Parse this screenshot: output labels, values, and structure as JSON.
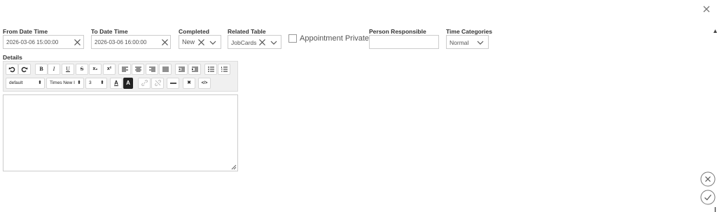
{
  "form": {
    "from_date": {
      "label": "From Date Time",
      "value": "2026-03-06 15:00:00"
    },
    "to_date": {
      "label": "To Date Time",
      "value": "2026-03-06 16:00:00"
    },
    "completed": {
      "label": "Completed",
      "value": "New"
    },
    "related_table": {
      "label": "Related Table",
      "value": "JobCards"
    },
    "appointment_private": {
      "label": "Appointment Private",
      "checked": false
    },
    "person_responsible": {
      "label": "Person Responsible",
      "value": ""
    },
    "time_categories": {
      "label": "Time Categories",
      "value": "Normal"
    }
  },
  "details": {
    "label": "Details",
    "toolbar": {
      "undo_icon": "undo-icon",
      "redo_icon": "redo-icon",
      "bold": "B",
      "italic": "I",
      "underline": "U",
      "strike": "S",
      "subscript": "x₂",
      "superscript": "x²",
      "font_size_style": "default",
      "font_name": "Times New I",
      "font_size": "3",
      "text_color": "A",
      "back_color": "A",
      "remove_format": "✖",
      "source": "</>"
    },
    "content": ""
  },
  "colors": {
    "border": "#cccccc",
    "toolbar_bg": "#f0f0f0",
    "label": "#333333"
  }
}
